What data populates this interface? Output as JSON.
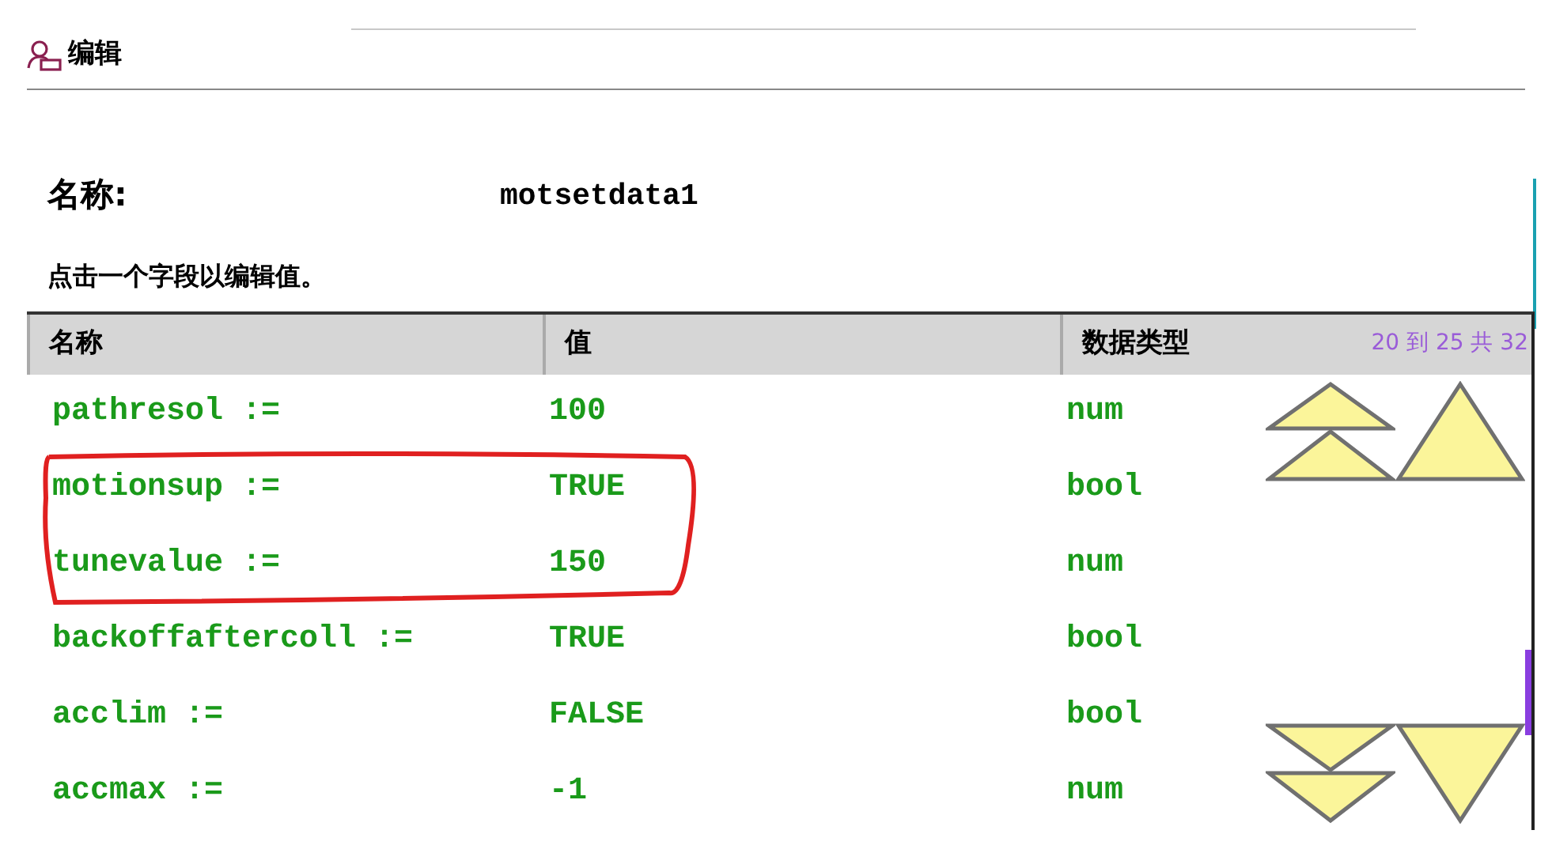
{
  "header": {
    "title": "编辑"
  },
  "name_field": {
    "label": "名称:",
    "value": "motsetdata1"
  },
  "instruction": "点击一个字段以编辑值。",
  "table": {
    "columns": [
      "名称",
      "值",
      "数据类型"
    ],
    "range": "20 到 25 共 32",
    "rows": [
      {
        "name": "pathresol :=",
        "value": "100",
        "type": "num"
      },
      {
        "name": "motionsup :=",
        "value": "TRUE",
        "type": "bool"
      },
      {
        "name": "tunevalue :=",
        "value": "150",
        "type": "num"
      },
      {
        "name": "backoffaftercoll :=",
        "value": "TRUE",
        "type": "bool"
      },
      {
        "name": "acclim :=",
        "value": "FALSE",
        "type": "bool"
      },
      {
        "name": "accmax :=",
        "value": "-1",
        "type": "num"
      }
    ]
  }
}
